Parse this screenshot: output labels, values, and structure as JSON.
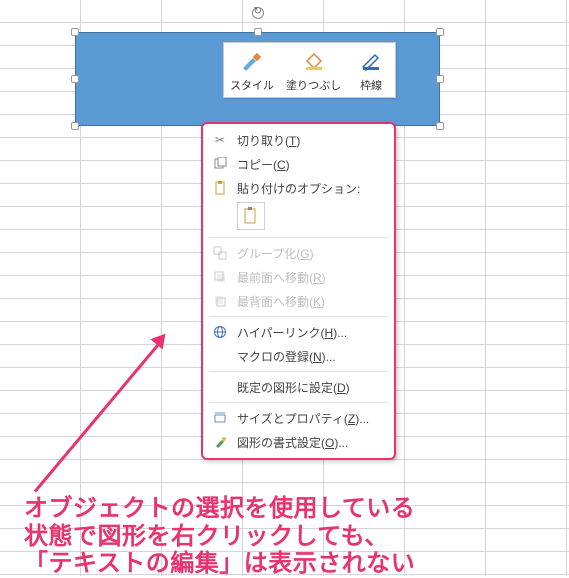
{
  "colors": {
    "accent": "#e8336e",
    "shape": "#5b9bd5"
  },
  "minitoolbar": {
    "style": "スタイル",
    "fill": "塗りつぶし",
    "outline": "枠線"
  },
  "context_menu": {
    "cut": "切り取り(T)",
    "copy": "コピー(C)",
    "paste_options_label": "貼り付けのオプション:",
    "group": "グループ化(G)",
    "bring_front": "最前面へ移動(R)",
    "send_back": "最背面へ移動(K)",
    "hyperlink": "ハイパーリンク(H)...",
    "assign_macro": "マクロの登録(N)...",
    "set_default": "既定の図形に設定(D)",
    "size_props": "サイズとプロパティ(Z)...",
    "format_shape": "図形の書式設定(O)..."
  },
  "caption": {
    "line1": "オブジェクトの選択を使用している",
    "line2": "状態で図形を右クリックしても、",
    "line3": "「テキストの編集」は表示されない"
  }
}
